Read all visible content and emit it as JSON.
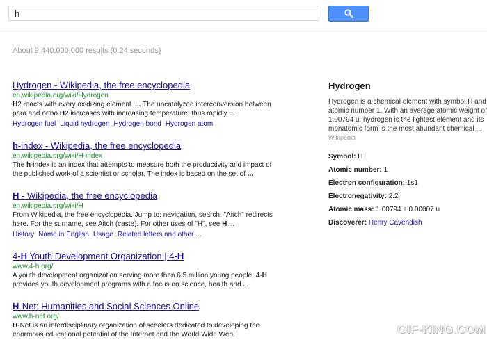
{
  "search": {
    "query": "h"
  },
  "stats": "About 9,440,000,000 results (0.24 seconds)",
  "results": [
    {
      "title_html": "Hydrogen - Wikipedia, the free encyclopedia",
      "url": "en.wikipedia.org/wiki/Hydrogen",
      "snippet_html": "<b>H</b>2 reacts with every oxidizing element. <b>...</b> The uncatalyzed interconversion between para and ortho <b>H</b>2 increases with increasing temperature; thus rapidly <b>...</b>",
      "sitelinks": [
        "Hydrogen fuel",
        "Liquid hydrogen",
        "Hydrogen bond",
        "Hydrogen atom"
      ]
    },
    {
      "title_html": "<b>h</b>-index - Wikipedia, the free encyclopedia",
      "url": "en.wikipedia.org/wiki/H-index",
      "snippet_html": "The <b>h</b>-index is an index that attempts to measure both the productivity and impact of the published work of a scientist or scholar. The index is based on the set of <b>...</b>",
      "sitelinks": []
    },
    {
      "title_html": "<b>H</b> - Wikipedia, the free encyclopedia",
      "url": "en.wikipedia.org/wiki/H",
      "snippet_html": "From Wikipedia, the free encyclopedia. Jump to: navigation, search. \"Aitch\" redirects here. For the surname, see Aitch (caste). For other uses of \"H\", see <b>H</b> <b>...</b>",
      "sitelinks": [
        "History",
        "Name in English",
        "Usage",
        "Related letters and other ..."
      ]
    },
    {
      "title_html": "4-<b>H</b> Youth Development Organization | 4-<b>H</b>",
      "url": "www.4-h.org/",
      "snippet_html": "A youth development organization serving more than 6.5 million young people, 4-<b>H</b> provides youth development programs with a focus on science, health and <b>...</b>",
      "sitelinks": []
    },
    {
      "title_html": "<b>H</b>-Net: Humanities and Social Sciences Online",
      "url": "www.h-net.org/",
      "snippet_html": "<b>H</b>-Net is an interdisciplinary organization of scholars dedicated to developing the enormous educational potential of the Internet and the World Wide Web.",
      "sitelinks": []
    }
  ],
  "knowledge_panel": {
    "title": "Hydrogen",
    "description": "Hydrogen is a chemical element with symbol H and atomic number 1. With an average atomic weight of 1.00794 u, hydrogen is the lightest element and its monatomic form is the most abundant chemical ...",
    "source": "Wikipedia",
    "facts": [
      {
        "key": "Symbol:",
        "value": "H"
      },
      {
        "key": "Atomic number:",
        "value": "1"
      },
      {
        "key": "Electron configuration:",
        "value": "1s1"
      },
      {
        "key": "Electronegativity:",
        "value": "2.2"
      },
      {
        "key": "Atomic mass:",
        "value": "1.00794 ± 0.00007 u"
      },
      {
        "key": "Discoverer:",
        "value": "Henry Cavendish",
        "link": true
      }
    ]
  },
  "watermark": "GIF-KING.COM",
  "colors": {
    "link": "#1a0dab",
    "url": "#1e8f2f",
    "button": "#4d90fe"
  },
  "icons": {
    "search_button": "magnifier-icon"
  }
}
